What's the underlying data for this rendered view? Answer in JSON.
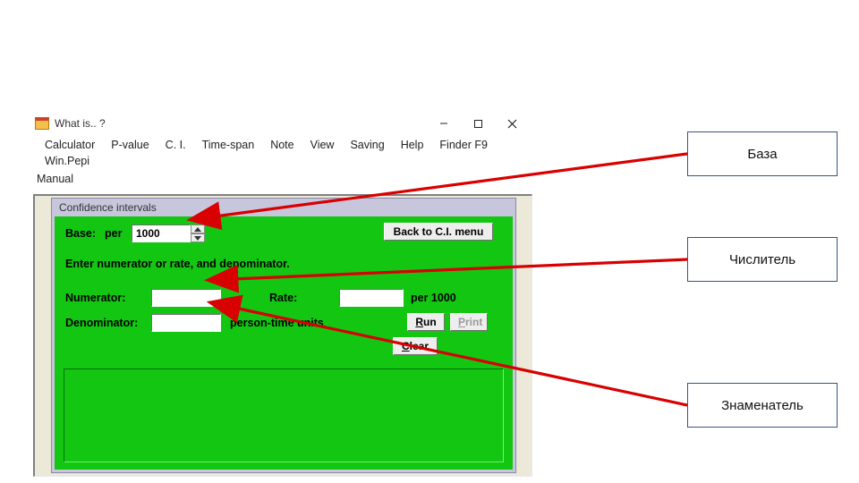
{
  "window": {
    "title": "What is.. ?"
  },
  "menu": {
    "items": [
      "Calculator",
      "P-value",
      "C. I.",
      "Time-span",
      "Note",
      "View",
      "Saving",
      "Help",
      "Finder F9",
      "Win.Pepi"
    ],
    "row2": "Manual"
  },
  "panel": {
    "title": "Confidence intervals",
    "base_label": "Base:",
    "per_label": "per",
    "base_value": "1000",
    "back_btn": "Back to C.I. menu",
    "instruction": "Enter numerator or rate, and denominator.",
    "numerator_label": "Numerator:",
    "numerator_value": "",
    "rate_label": "Rate:",
    "rate_value": "",
    "rate_suffix": "per 1000",
    "denom_label": "Denominator:",
    "denom_value": "",
    "denom_suffix": "person-time units",
    "run_btn": "Run",
    "print_btn": "Print",
    "clear_btn": "Clear"
  },
  "callouts": {
    "a": "База",
    "b": "Числитель",
    "c": "Знаменатель"
  },
  "arrows": {
    "color": "#d80000"
  }
}
